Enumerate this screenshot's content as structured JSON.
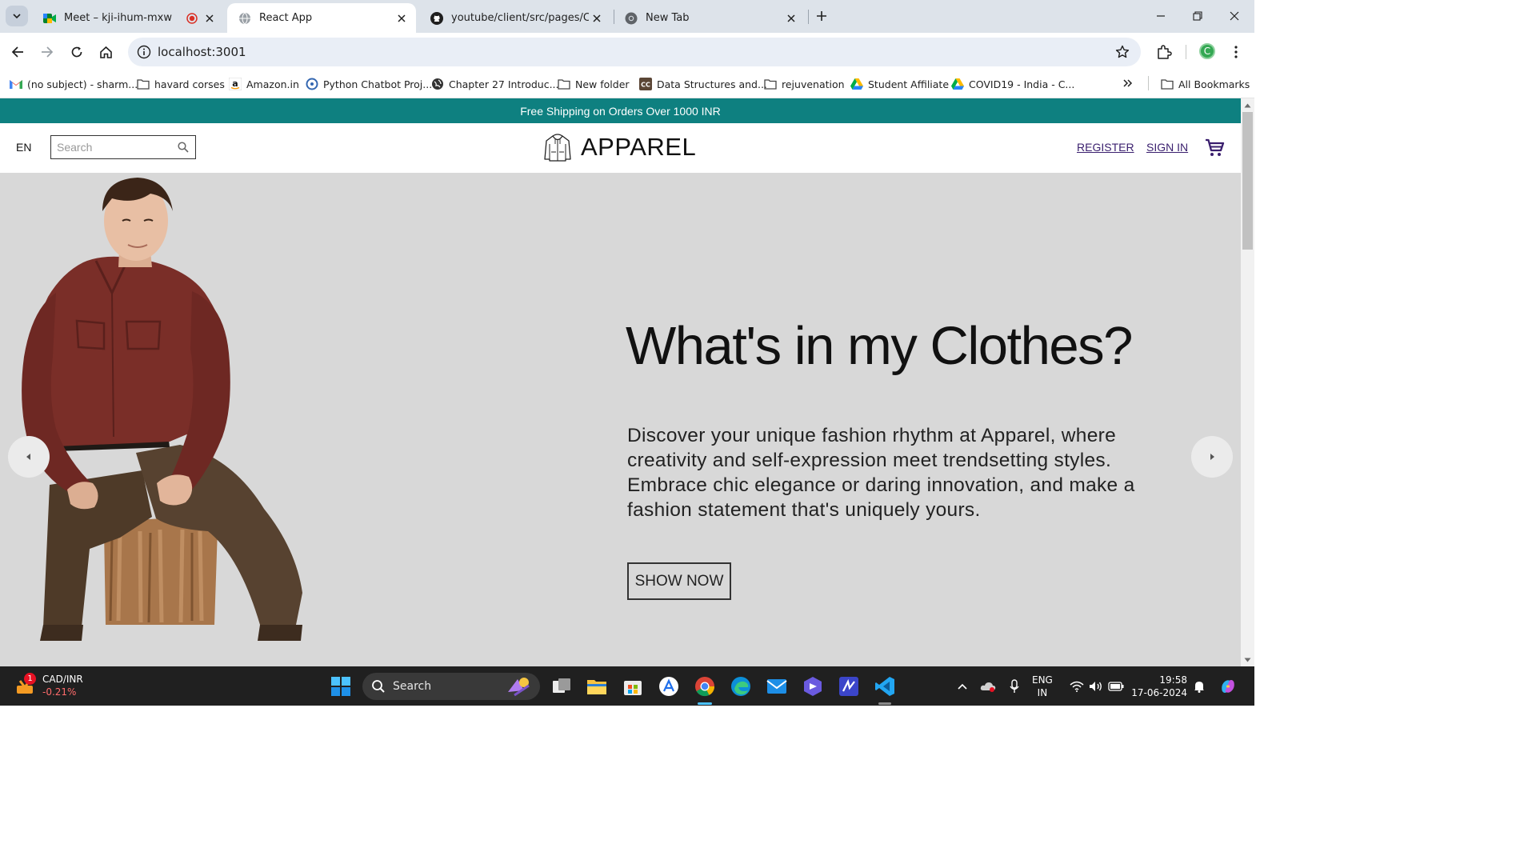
{
  "browser": {
    "tabs": [
      {
        "title": "Meet – kji-ihum-mxw",
        "icon": "google-meet-icon",
        "recording": true
      },
      {
        "title": "React App",
        "icon": "globe-icon",
        "active": true
      },
      {
        "title": "youtube/client/src/pages/Cart.js",
        "icon": "github-icon"
      },
      {
        "title": "New Tab",
        "icon": "chrome-icon"
      }
    ],
    "url": "localhost:3001",
    "profile_initial": "C",
    "bookmarks": [
      {
        "label": "(no subject) - sharm...",
        "icon": "gmail-icon"
      },
      {
        "label": "havard corses",
        "icon": "folder-icon"
      },
      {
        "label": "Amazon.in",
        "icon": "amazon-icon"
      },
      {
        "label": "Python Chatbot Proj...",
        "icon": "python-icon"
      },
      {
        "label": "Chapter 27 Introduc...",
        "icon": "globe-icon"
      },
      {
        "label": "New folder",
        "icon": "folder-icon"
      },
      {
        "label": "Data Structures and...",
        "icon": "cc-icon"
      },
      {
        "label": "rejuvenation",
        "icon": "folder-icon"
      },
      {
        "label": "Student Affiliate",
        "icon": "drive-icon"
      },
      {
        "label": "COVID19 - India - C...",
        "icon": "drive-icon"
      }
    ],
    "all_bookmarks": "All Bookmarks"
  },
  "site": {
    "announcement": "Free Shipping on Orders Over 1000 INR",
    "lang": "EN",
    "search_placeholder": "Search",
    "brand": "APPAREL",
    "register": "REGISTER",
    "signin": "SIGN IN",
    "hero": {
      "title": "What's in my Clothes?",
      "description": "Discover your unique fashion rhythm at Apparel, where creativity and self-expression meet trendsetting styles. Embrace chic elegance or daring innovation, and make a fashion statement that's uniquely yours.",
      "button": "SHOW NOW"
    }
  },
  "taskbar": {
    "widget": {
      "title": "CAD/INR",
      "change": "-0.21%",
      "badge": "1"
    },
    "search": "Search",
    "lang_line1": "ENG",
    "lang_line2": "IN",
    "time": "19:58",
    "date": "17-06-2024"
  },
  "colors": {
    "announcement_bg": "#0e8080",
    "hero_bg": "#d8d8d8",
    "link": "#3a1f6e",
    "shirt": "#7a2e28",
    "trousers": "#4e3a28"
  }
}
